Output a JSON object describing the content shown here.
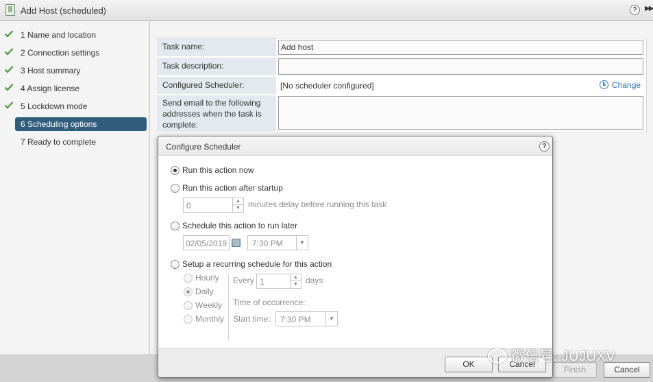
{
  "window": {
    "title": "Add Host (scheduled)",
    "help_glyph": "?",
    "expand_glyph": "▶▶"
  },
  "nav": {
    "steps": [
      {
        "label": "1  Name and location",
        "state": "done"
      },
      {
        "label": "2  Connection settings",
        "state": "done"
      },
      {
        "label": "3  Host summary",
        "state": "done"
      },
      {
        "label": "4  Assign license",
        "state": "done"
      },
      {
        "label": "5  Lockdown mode",
        "state": "done"
      },
      {
        "label": "6  Scheduling options",
        "state": "active"
      },
      {
        "label": "7  Ready to complete",
        "state": "pending"
      }
    ]
  },
  "form": {
    "task_name_label": "Task name:",
    "task_name_value": "Add host",
    "task_description_label": "Task description:",
    "task_description_value": "",
    "configured_scheduler_label": "Configured Scheduler:",
    "configured_scheduler_value": "[No scheduler configured]",
    "change_link": "Change",
    "email_label": "Send email to the following addresses when the task is complete:",
    "email_value": ""
  },
  "dialog": {
    "title": "Configure Scheduler",
    "help_glyph": "?",
    "options": {
      "run_now": "Run this action now",
      "after_startup": "Run this action after startup",
      "schedule_later": "Schedule this action to run later",
      "recurring": "Setup a recurring schedule for this action"
    },
    "selected_option": "run_now",
    "startup_delay_value": "0",
    "startup_delay_suffix": "minutes delay before running this task",
    "later_date": "02/05/2019",
    "later_time": "7:30 PM",
    "recurrence": {
      "hourly": "Hourly",
      "daily": "Daily",
      "weekly": "Weekly",
      "monthly": "Monthly",
      "selected": "daily",
      "every_label": "Every",
      "every_value": "1",
      "days_label": "days",
      "time_of_occurrence_label": "Time of occurrence:",
      "start_time_label": "Start time:",
      "start_time_value": "7:30 PM"
    },
    "ok_label": "OK",
    "cancel_label": "Cancel"
  },
  "footer": {
    "finish_label": "Finish",
    "cancel_label": "Cancel"
  },
  "watermark": {
    "text": "微信号: JUJUXV"
  },
  "colors": {
    "active_step": "#315d7d",
    "check": "#4a9a3a",
    "link": "#2e6fb3",
    "label_bg": "#e3e9ef"
  }
}
